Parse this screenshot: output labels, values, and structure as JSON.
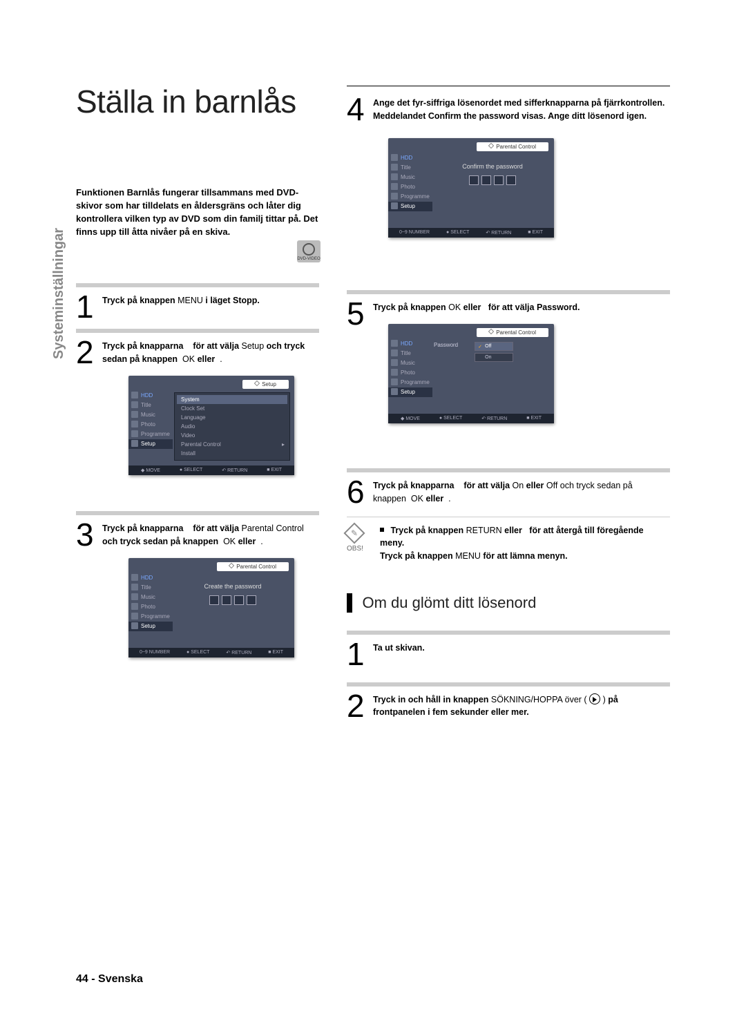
{
  "title": "Ställa in barnlås",
  "sidebar_label": "Systeminställningar",
  "intro": "Funktionen Barnlås fungerar tillsammans med DVD-skivor som har tilldelats en åldersgräns och låter dig kontrollera vilken typ av DVD som din familj tittar på. Det finns upp till åtta nivåer på en skiva.",
  "dvd_badge": "DVD-VIDEO",
  "steps": {
    "s1": {
      "num": "1",
      "a": "Tryck på knappen",
      "b": "MENU",
      "c": "i läget Stopp."
    },
    "s2": {
      "num": "2",
      "a": "Tryck på knapparna",
      "b": "för att välja",
      "c": "Setup",
      "d": "och tryck sedan på knappen",
      "e": "OK",
      "f": "eller"
    },
    "s3": {
      "num": "3",
      "a": "Tryck på knapparna",
      "b": "för att välja",
      "c": "Parental Control",
      "d": "och tryck sedan på knappen",
      "e": "OK",
      "f": "eller"
    },
    "s4": {
      "num": "4",
      "a": "Ange det fyr-siffriga lösenordet med sifferknapparna på fjärrkontrollen. Meddelandet Confirm the password visas. Ange ditt lösenord igen."
    },
    "s5": {
      "num": "5",
      "a": "Tryck på knappen",
      "b": "OK",
      "c": "eller",
      "d": "för att välja Password."
    },
    "s6": {
      "num": "6",
      "a": "Tryck på knapparna",
      "b": "för att välja",
      "c": "On",
      "d": "eller",
      "e": "Off och tryck sedan på knappen",
      "f": "OK",
      "g": "eller"
    }
  },
  "note": {
    "label": "OBS!",
    "l1a": "Tryck på knappen",
    "l1b": "RETURN",
    "l1c": "eller",
    "l1d": "för att återgå till föregående meny.",
    "l2a": "Tryck på knappen",
    "l2b": "MENU",
    "l2c": "för att lämna menyn."
  },
  "sub": {
    "heading": "Om du glömt ditt lösenord"
  },
  "sub_s1": {
    "num": "1",
    "a": "Ta ut skivan."
  },
  "sub_s2": {
    "num": "2",
    "a": "Tryck in och håll in knappen",
    "b": "SÖKNING/HOPPA över (",
    "c": ")",
    "d": "på frontpanelen i fem sekunder eller mer."
  },
  "osd": {
    "setup": "Setup",
    "parental": "Parental Control",
    "hdd": "HDD",
    "title_item": "Title",
    "music": "Music",
    "photo": "Photo",
    "programme": "Programme",
    "setup_item": "Setup",
    "menu2": {
      "system": "System",
      "clock": "Clock Set",
      "lang": "Language",
      "audio": "Audio",
      "video": "Video",
      "parental": "Parental Control",
      "install": "Install"
    },
    "create_pw": "Create the password",
    "confirm_pw": "Confirm the password",
    "password": "Password",
    "off": "Off",
    "on": "On",
    "btn_number": "0~9 NUMBER",
    "btn_move": "MOVE",
    "btn_select": "SELECT",
    "btn_return": "RETURN",
    "btn_exit": "EXIT"
  },
  "footer": {
    "page": "44",
    "dash": " - ",
    "lang": "Svenska"
  }
}
